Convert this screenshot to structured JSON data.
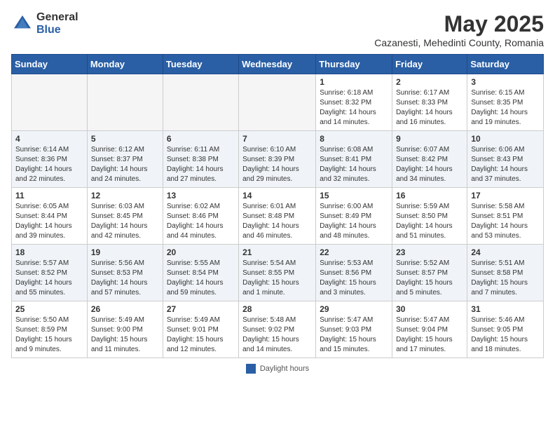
{
  "header": {
    "logo_general": "General",
    "logo_blue": "Blue",
    "month_title": "May 2025",
    "subtitle": "Cazanesti, Mehedinti County, Romania"
  },
  "days_of_week": [
    "Sunday",
    "Monday",
    "Tuesday",
    "Wednesday",
    "Thursday",
    "Friday",
    "Saturday"
  ],
  "weeks": [
    [
      {
        "day": "",
        "info": ""
      },
      {
        "day": "",
        "info": ""
      },
      {
        "day": "",
        "info": ""
      },
      {
        "day": "",
        "info": ""
      },
      {
        "day": "1",
        "info": "Sunrise: 6:18 AM\nSunset: 8:32 PM\nDaylight: 14 hours\nand 14 minutes."
      },
      {
        "day": "2",
        "info": "Sunrise: 6:17 AM\nSunset: 8:33 PM\nDaylight: 14 hours\nand 16 minutes."
      },
      {
        "day": "3",
        "info": "Sunrise: 6:15 AM\nSunset: 8:35 PM\nDaylight: 14 hours\nand 19 minutes."
      }
    ],
    [
      {
        "day": "4",
        "info": "Sunrise: 6:14 AM\nSunset: 8:36 PM\nDaylight: 14 hours\nand 22 minutes."
      },
      {
        "day": "5",
        "info": "Sunrise: 6:12 AM\nSunset: 8:37 PM\nDaylight: 14 hours\nand 24 minutes."
      },
      {
        "day": "6",
        "info": "Sunrise: 6:11 AM\nSunset: 8:38 PM\nDaylight: 14 hours\nand 27 minutes."
      },
      {
        "day": "7",
        "info": "Sunrise: 6:10 AM\nSunset: 8:39 PM\nDaylight: 14 hours\nand 29 minutes."
      },
      {
        "day": "8",
        "info": "Sunrise: 6:08 AM\nSunset: 8:41 PM\nDaylight: 14 hours\nand 32 minutes."
      },
      {
        "day": "9",
        "info": "Sunrise: 6:07 AM\nSunset: 8:42 PM\nDaylight: 14 hours\nand 34 minutes."
      },
      {
        "day": "10",
        "info": "Sunrise: 6:06 AM\nSunset: 8:43 PM\nDaylight: 14 hours\nand 37 minutes."
      }
    ],
    [
      {
        "day": "11",
        "info": "Sunrise: 6:05 AM\nSunset: 8:44 PM\nDaylight: 14 hours\nand 39 minutes."
      },
      {
        "day": "12",
        "info": "Sunrise: 6:03 AM\nSunset: 8:45 PM\nDaylight: 14 hours\nand 42 minutes."
      },
      {
        "day": "13",
        "info": "Sunrise: 6:02 AM\nSunset: 8:46 PM\nDaylight: 14 hours\nand 44 minutes."
      },
      {
        "day": "14",
        "info": "Sunrise: 6:01 AM\nSunset: 8:48 PM\nDaylight: 14 hours\nand 46 minutes."
      },
      {
        "day": "15",
        "info": "Sunrise: 6:00 AM\nSunset: 8:49 PM\nDaylight: 14 hours\nand 48 minutes."
      },
      {
        "day": "16",
        "info": "Sunrise: 5:59 AM\nSunset: 8:50 PM\nDaylight: 14 hours\nand 51 minutes."
      },
      {
        "day": "17",
        "info": "Sunrise: 5:58 AM\nSunset: 8:51 PM\nDaylight: 14 hours\nand 53 minutes."
      }
    ],
    [
      {
        "day": "18",
        "info": "Sunrise: 5:57 AM\nSunset: 8:52 PM\nDaylight: 14 hours\nand 55 minutes."
      },
      {
        "day": "19",
        "info": "Sunrise: 5:56 AM\nSunset: 8:53 PM\nDaylight: 14 hours\nand 57 minutes."
      },
      {
        "day": "20",
        "info": "Sunrise: 5:55 AM\nSunset: 8:54 PM\nDaylight: 14 hours\nand 59 minutes."
      },
      {
        "day": "21",
        "info": "Sunrise: 5:54 AM\nSunset: 8:55 PM\nDaylight: 15 hours\nand 1 minute."
      },
      {
        "day": "22",
        "info": "Sunrise: 5:53 AM\nSunset: 8:56 PM\nDaylight: 15 hours\nand 3 minutes."
      },
      {
        "day": "23",
        "info": "Sunrise: 5:52 AM\nSunset: 8:57 PM\nDaylight: 15 hours\nand 5 minutes."
      },
      {
        "day": "24",
        "info": "Sunrise: 5:51 AM\nSunset: 8:58 PM\nDaylight: 15 hours\nand 7 minutes."
      }
    ],
    [
      {
        "day": "25",
        "info": "Sunrise: 5:50 AM\nSunset: 8:59 PM\nDaylight: 15 hours\nand 9 minutes."
      },
      {
        "day": "26",
        "info": "Sunrise: 5:49 AM\nSunset: 9:00 PM\nDaylight: 15 hours\nand 11 minutes."
      },
      {
        "day": "27",
        "info": "Sunrise: 5:49 AM\nSunset: 9:01 PM\nDaylight: 15 hours\nand 12 minutes."
      },
      {
        "day": "28",
        "info": "Sunrise: 5:48 AM\nSunset: 9:02 PM\nDaylight: 15 hours\nand 14 minutes."
      },
      {
        "day": "29",
        "info": "Sunrise: 5:47 AM\nSunset: 9:03 PM\nDaylight: 15 hours\nand 15 minutes."
      },
      {
        "day": "30",
        "info": "Sunrise: 5:47 AM\nSunset: 9:04 PM\nDaylight: 15 hours\nand 17 minutes."
      },
      {
        "day": "31",
        "info": "Sunrise: 5:46 AM\nSunset: 9:05 PM\nDaylight: 15 hours\nand 18 minutes."
      }
    ]
  ],
  "footer": {
    "legend_label": "Daylight hours"
  }
}
